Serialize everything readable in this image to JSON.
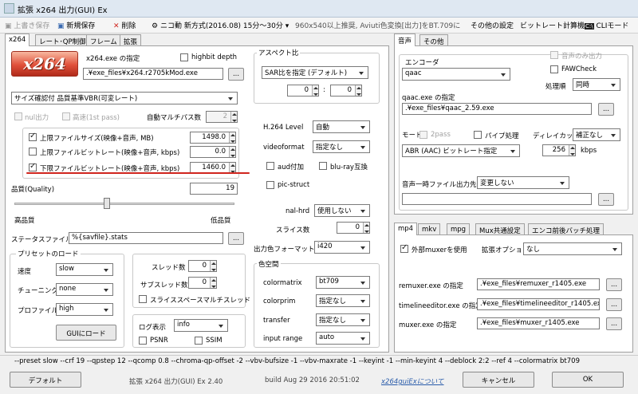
{
  "window": {
    "title": "拡張 x264 出力(GUI) Ex"
  },
  "toolbar": {
    "overwrite": "上書き保存",
    "new_save": "新規保存",
    "delete": "削除",
    "preset": "ニコ動 新方式(2016.08) 15分～30分",
    "preset_desc": "960x540以上推奨, Aviuti色変換[出力]をBT.709に",
    "other_settings": "その他の設定",
    "bitrate_calc": "ビットレート計算機",
    "cli_mode": "CLIモード"
  },
  "left_tabs": [
    "x264",
    "レート･QP制御",
    "フレーム",
    "拡張"
  ],
  "x264": {
    "logo_text": "x264",
    "exe_label": "x264.exe の指定",
    "highbit_label": "highbit depth",
    "exe_path": ".¥exe_files¥x264.r2705kMod.exe",
    "browse": "...",
    "mode": "サイズ確認付 品質基準VBR(可変レート)",
    "null_out": "nul出力",
    "fast_1pass": "高速(1st pass)",
    "auto_multipass": "自動マルチパス数",
    "auto_multipass_val": "2",
    "limit_size_label": "上限ファイルサイズ(映像+音声, MB)",
    "limit_size_val": "1498.0",
    "limit_bitrate_label": "上限ファイルビットレート(映像+音声, kbps)",
    "limit_bitrate_val": "0.0",
    "lower_bitrate_label": "下限ファイルビットレート(映像+音声, kbps)",
    "lower_bitrate_val": "1460.0",
    "quality_label": "品質(Quality)",
    "quality_val": "19",
    "quality_slider": 0.42,
    "high_quality": "高品質",
    "low_quality": "低品質",
    "stats_label": "ステータスファイル",
    "stats_val": "%{savfile}.stats",
    "preset_load": "プリセットのロード",
    "speed_label": "速度",
    "speed_val": "slow",
    "tune_label": "チューニング",
    "tune_val": "none",
    "profile_label": "プロファイル",
    "profile_val": "high",
    "gui_load": "GUIにロード",
    "threads_label": "スレッド数",
    "threads_val": "0",
    "subthreads_label": "サブスレッド数",
    "subthreads_val": "0",
    "slice_thread": "スライススペースマルチスレッド",
    "log_label": "ログ表示",
    "log_val": "info",
    "psnr": "PSNR",
    "ssim": "SSIM",
    "aspect_label": "アスペクト比",
    "aspect_val": "SAR比を指定 (デフォルト)",
    "aspect_w": "0",
    "aspect_h": "0",
    "aspect_sep": ":",
    "h264_level_label": "H.264 Level",
    "h264_level_val": "自動",
    "videoformat_label": "videoformat",
    "videoformat_val": "指定なし",
    "aud": "aud付加",
    "bluray": "blu-ray互換",
    "picstruct": "pic-struct",
    "nalhrd_label": "nal-hrd",
    "nalhrd_val": "使用しない",
    "slices_label": "スライス数",
    "slices_val": "0",
    "outcolor_label": "出力色フォーマット",
    "outcolor_val": "i420",
    "colorspace_label": "色空間",
    "colormatrix_label": "colormatrix",
    "colormatrix_val": "bt709",
    "colorprim_label": "colorprim",
    "colorprim_val": "指定なし",
    "transfer_label": "transfer",
    "transfer_val": "指定なし",
    "inputrange_label": "input range",
    "inputrange_val": "auto"
  },
  "audio_tabs": [
    "音声",
    "その他"
  ],
  "audio": {
    "encoder_label": "エンコーダ",
    "encoder_val": "qaac",
    "audio_only": "音声のみ出力",
    "fawcheck": "FAWCheck",
    "order_label": "処理順",
    "order_val": "同時",
    "exe_label": "qaac.exe の指定",
    "exe_path": ".¥exe_files¥qaac_2.59.exe",
    "mode_label": "モード",
    "twopass": "2pass",
    "pipe": "パイプ処理",
    "delay_label": "ディレイカット",
    "delay_val": "補正なし",
    "mode_val": "ABR (AAC) ビットレート指定",
    "bitrate_val": "256",
    "kbps": "kbps",
    "temp_label": "音声一時ファイル出力先",
    "temp_val": "変更しない",
    "temp_path": ""
  },
  "mux_tabs": [
    "mp4",
    "mkv",
    "mpg",
    "Mux共通設定",
    "エンコ前後バッチ処理"
  ],
  "mux": {
    "external": "外部muxerを使用",
    "ext_opt_label": "拡張オプション",
    "ext_opt_val": "なし",
    "remuxer_label": "remuxer.exe の指定",
    "remuxer_path": ".¥exe_files¥remuxer_r1405.exe",
    "timeline_label": "timelineeditor.exe の指定",
    "timeline_path": ".¥exe_files¥timelineeditor_r1405.exe",
    "muxer_label": "muxer.exe の指定",
    "muxer_path": ".¥exe_files¥muxer_r1405.exe"
  },
  "cmdline": "--preset slow --crf 19 --qpstep 12 --qcomp 0.8 --chroma-qp-offset -2 --vbv-bufsize -1 --vbv-maxrate -1 --keyint -1 --min-keyint 4 --deblock 2:2 --ref 4 --colormatrix bt709",
  "footer": {
    "default": "デフォルト",
    "version": "拡張 x264 出力(GUI) Ex 2.40",
    "build": "build Aug 29 2016 20:51:02",
    "about": "x264guiExについて",
    "cancel": "キャンセル",
    "ok": "OK"
  },
  "colors": {
    "accent_red": "#d0251e",
    "logo_red": "#e0503a",
    "link": "#2a5caa"
  }
}
